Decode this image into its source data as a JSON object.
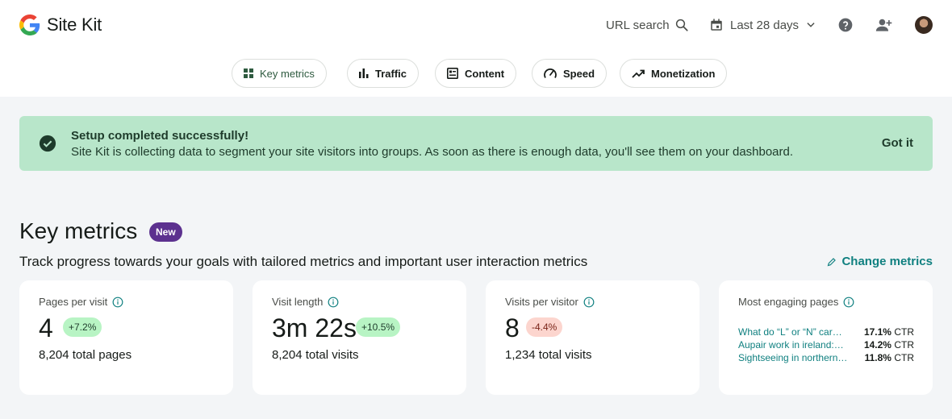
{
  "app": {
    "name": "Site Kit"
  },
  "header": {
    "url_search_label": "URL search",
    "date_range_label": "Last 28 days"
  },
  "tabs": [
    {
      "label": "Key metrics",
      "active": true,
      "icon": "grid-icon"
    },
    {
      "label": "Traffic",
      "active": false,
      "icon": "bar-chart-icon"
    },
    {
      "label": "Content",
      "active": false,
      "icon": "content-icon"
    },
    {
      "label": "Speed",
      "active": false,
      "icon": "speedometer-icon"
    },
    {
      "label": "Monetization",
      "active": false,
      "icon": "trending-up-icon"
    }
  ],
  "banner": {
    "title": "Setup completed successfully!",
    "text": "Site Kit is collecting data to segment your site visitors into groups. As soon as there is enough data, you'll see them on your dashboard.",
    "button_label": "Got it"
  },
  "key_metrics": {
    "title": "Key metrics",
    "badge": "New",
    "description": "Track progress towards your goals with tailored metrics and important user interaction metrics",
    "change_metrics_label": "Change metrics",
    "cards": [
      {
        "label": "Pages per visit",
        "value": "4",
        "change": "+7.2%",
        "direction": "up",
        "subtext": "8,204 total pages"
      },
      {
        "label": "Visit length",
        "value": "3m 22s",
        "change": "+10.5%",
        "direction": "up",
        "subtext": "8,204 total visits"
      },
      {
        "label": "Visits per visitor",
        "value": "8",
        "change": "-4.4%",
        "direction": "down",
        "subtext": "1,234 total visits"
      }
    ],
    "engaging_pages": {
      "label": "Most engaging pages",
      "ctr_unit": "CTR",
      "rows": [
        {
          "title": "What do “L” or “N” car…",
          "ctr": "17.1%"
        },
        {
          "title": "Aupair work in ireland:…",
          "ctr": "14.2%"
        },
        {
          "title": "Sightseeing in northern…",
          "ctr": "11.8%"
        }
      ]
    }
  },
  "colors": {
    "brand_green": "#2e5a3f",
    "banner_bg": "#b8e6ca",
    "link_teal": "#108080",
    "new_badge": "#5c318f",
    "up_badge": "#b8f4c4",
    "down_badge": "#fcd5ce"
  }
}
